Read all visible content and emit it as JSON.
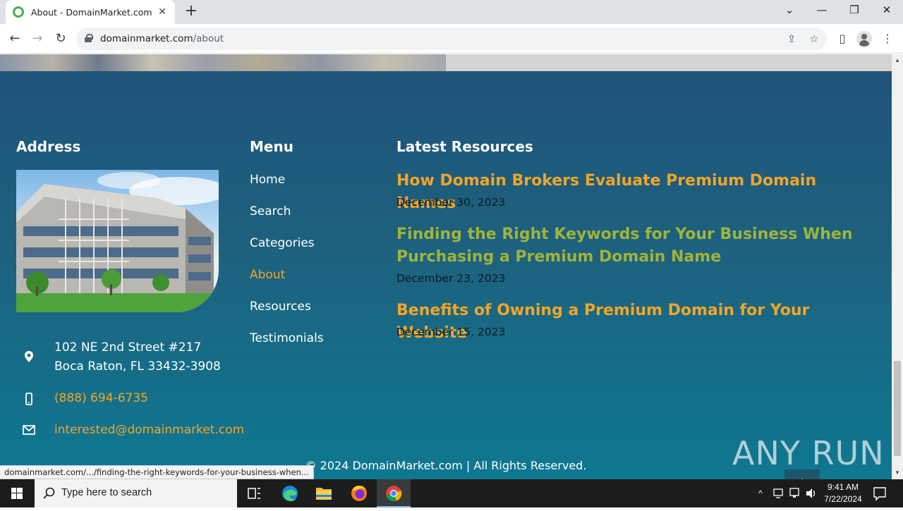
{
  "browser": {
    "tab_title": "About - DomainMarket.com",
    "url_host": "domainmarket.com",
    "url_path": "/about",
    "status_url": "domainmarket.com/.../finding-the-right-keywords-for-your-business-when..."
  },
  "footer": {
    "address_heading": "Address",
    "address_line1": "102 NE 2nd Street #217",
    "address_line2": "Boca Raton, FL 33432-3908",
    "phone": "(888) 694-6735",
    "email": "interested@domainmarket.com",
    "menu_heading": "Menu",
    "menu": [
      "Home",
      "Search",
      "Categories",
      "About",
      "Resources",
      "Testimonials"
    ],
    "resources_heading": "Latest Resources",
    "resources": [
      {
        "title": "How Domain Brokers Evaluate Premium Domain Names",
        "date": "December 30, 2023"
      },
      {
        "title": "Finding the Right Keywords for Your Business When Purchasing a Premium Domain Name",
        "date": "December 23, 2023"
      },
      {
        "title": "Benefits of Owning a Premium Domain for Your Website",
        "date": "December 15, 2023"
      }
    ],
    "copyright": "© 2024 DomainMarket.com | All Rights Reserved."
  },
  "watermark": "ANY RUN",
  "taskbar": {
    "search_placeholder": "Type here to search",
    "time": "9:41 AM",
    "date": "7/22/2024"
  },
  "colors": {
    "accent_orange": "#f0a52a",
    "hover_green": "#9fb43a",
    "footer_top": "#1f5378",
    "footer_bottom": "#0e7891"
  }
}
